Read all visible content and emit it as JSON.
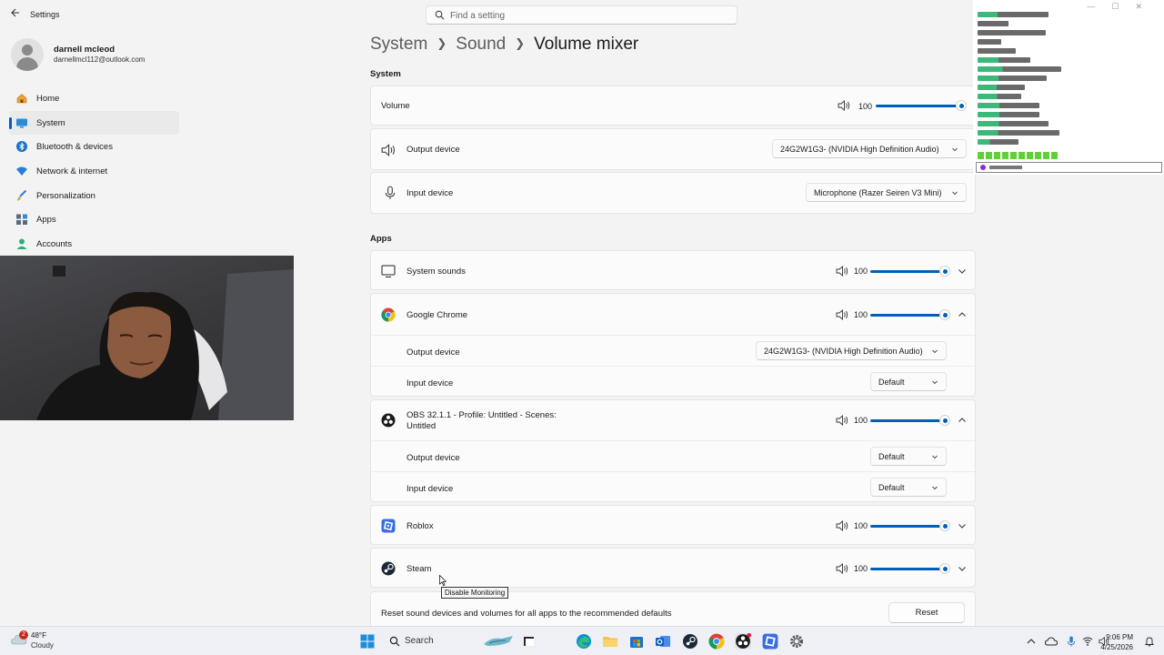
{
  "window": {
    "title": "Settings"
  },
  "search": {
    "placeholder": "Find a setting"
  },
  "user": {
    "name": "darnell mcleod",
    "email": "darnellmcl112@outlook.com"
  },
  "nav": {
    "items": [
      {
        "label": "Home",
        "icon": "home-icon"
      },
      {
        "label": "System",
        "icon": "system-icon",
        "active": true
      },
      {
        "label": "Bluetooth & devices",
        "icon": "bluetooth-icon"
      },
      {
        "label": "Network & internet",
        "icon": "network-icon"
      },
      {
        "label": "Personalization",
        "icon": "brush-icon"
      },
      {
        "label": "Apps",
        "icon": "apps-icon"
      },
      {
        "label": "Accounts",
        "icon": "account-icon"
      }
    ]
  },
  "breadcrumb": {
    "part1": "System",
    "part2": "Sound",
    "current": "Volume mixer"
  },
  "system_section": {
    "heading": "System",
    "volume": {
      "label": "Volume",
      "value": "100",
      "level": 1.0
    },
    "output_device": {
      "label": "Output device",
      "value": "24G2W1G3- (NVIDIA High Definition Audio)"
    },
    "input_device": {
      "label": "Input device",
      "value": "Microphone (Razer Seiren V3 Mini)"
    }
  },
  "apps_section": {
    "heading": "Apps",
    "system_sounds": {
      "label": "System sounds",
      "value": "100",
      "level": 1.0
    },
    "chrome": {
      "label": "Google Chrome",
      "value": "100",
      "level": 1.0,
      "output_label": "Output device",
      "output_value": "24G2W1G3- (NVIDIA High Definition Audio)",
      "input_label": "Input device",
      "input_value": "Default"
    },
    "obs": {
      "label_line1": "OBS 32.1.1 - Profile: Untitled - Scenes:",
      "label_line2": "Untitled",
      "value": "100",
      "level": 1.0,
      "output_label": "Output device",
      "output_value": "Default",
      "input_label": "Input device",
      "input_value": "Default"
    },
    "roblox": {
      "label": "Roblox",
      "value": "100",
      "level": 1.0
    },
    "steam": {
      "label": "Steam",
      "value": "100",
      "level": 1.0
    }
  },
  "reset": {
    "text": "Reset sound devices and volumes for all apps to the recommended defaults",
    "button": "Reset"
  },
  "tooltip": {
    "text": "Disable Monitoring"
  },
  "taskbar": {
    "weather_temp": "48°F",
    "weather_desc": "Cloudy",
    "weather_badge": "2",
    "search_label": "Search",
    "time": "9:06 PM",
    "date": "4/25/2026"
  },
  "colors": {
    "accent": "#005fb8",
    "background": "#f3f3f3",
    "card": "#fbfbfb"
  }
}
